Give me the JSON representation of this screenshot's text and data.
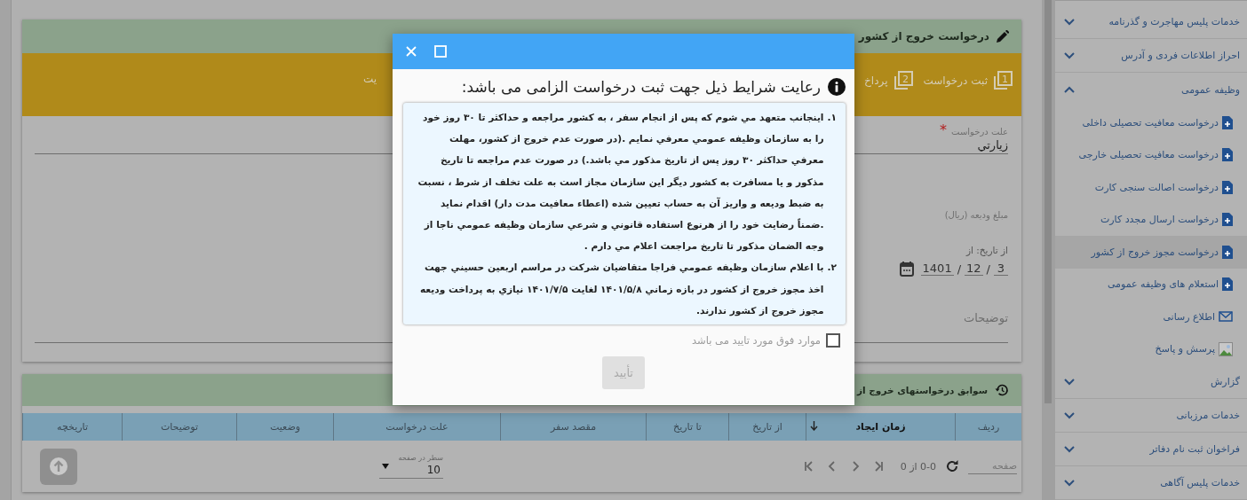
{
  "form_panel": {
    "title": "درخواست خروج از کشور",
    "steps": [
      {
        "number": "1",
        "label": "ثبت درخواست"
      },
      {
        "number": "2",
        "label": "پرداخ"
      },
      {
        "label": "يت"
      }
    ],
    "fields": [
      {
        "kind": "text",
        "label": "علت درخواست",
        "required_mark": "*",
        "value": "زيارتي"
      },
      {
        "kind": "label",
        "label": "مبلغ وديعه (ريال)"
      },
      {
        "kind": "date",
        "label": "از تاريخ: از",
        "parts": [
          {
            "kind": "field",
            "text": "3"
          },
          {
            "kind": "sep",
            "text": "/"
          },
          {
            "kind": "field",
            "text": "12"
          },
          {
            "kind": "sep",
            "text": "/"
          },
          {
            "kind": "field",
            "text": "1401"
          }
        ]
      },
      {
        "kind": "area",
        "placeholder": "توضيحات"
      }
    ]
  },
  "history_panel": {
    "title": "سوابق درخواستهای خروج از",
    "columns": [
      {
        "label": "ردیف",
        "sorted": false
      },
      {
        "label": "زمان ایجاد",
        "sorted": true
      },
      {
        "label": "از تاریخ",
        "sorted": false
      },
      {
        "label": "تا تاریخ",
        "sorted": false
      },
      {
        "label": "مقصد سفر",
        "sorted": false
      },
      {
        "label": "علت درخواست",
        "sorted": false
      },
      {
        "label": "وضعیت",
        "sorted": false
      },
      {
        "label": "توضیحات",
        "sorted": false
      },
      {
        "label": "تاریخچه",
        "sorted": false
      }
    ],
    "page_field": {
      "placeholder": "صفحه"
    },
    "range": "0-0 از 0",
    "page_size": {
      "label": "سطر در صفحه",
      "value": "10"
    }
  },
  "sidebar": {
    "items": [
      {
        "label": "خدمات پلیس مهاجرت و گذرنامه",
        "expanded": false
      },
      {
        "label": "احراز اطلاعات فردی و آدرس",
        "expanded": false
      },
      {
        "label": "وظیفه عمومی",
        "expanded": true,
        "children": [
          {
            "label": "درخواست معافیت تحصیلی داخلی",
            "kind": "document",
            "selected": false
          },
          {
            "label": "درخواست معافیت تحصیلی خارجی",
            "kind": "document",
            "selected": false
          },
          {
            "label": "درخواست اصالت سنجی کارت",
            "kind": "document",
            "selected": false
          },
          {
            "label": "درخواست ارسال مجدد کارت",
            "kind": "document",
            "selected": false
          },
          {
            "label": "درخواست مجوز خروج از کشور",
            "kind": "document",
            "selected": true
          },
          {
            "label": "استعلام های وظیفه عمومی",
            "kind": "document",
            "selected": false
          },
          {
            "label": "اطلاع رسانی",
            "kind": "mail",
            "selected": false
          },
          {
            "label": "پرسش و پاسخ",
            "kind": "image",
            "selected": false
          }
        ]
      },
      {
        "label": "گزارش",
        "expanded": false
      },
      {
        "label": "خدمات مرزبانی",
        "expanded": false
      },
      {
        "label": "فراخوان ثبت نام دفاتر",
        "expanded": false
      },
      {
        "label": "خدمات پلیس آگاهی",
        "expanded": false
      }
    ]
  },
  "dialog": {
    "title": "رعایت شرایط ذیل جهت ثبت درخواست الزامی می باشد:",
    "terms": [
      {
        "number": "۱.",
        "text": "اينجانب متعهد مي شوم که پس از انجام سفر ، به کشور مراجعه و حداکثر تا ۳۰ روز خود را به سازمان وظيفه عمومي معرفي نمايم .(در صورت عدم خروج از کشور، مهلت معرفي حداکثر ۳۰ روز پس از تاريخ مذکور مي باشد.) در صورت عدم مراجعه تا تاريخ مذکور و يا مسافرت به کشور ديگر اين سازمان مجاز است به علت تخلف از شرط ، نسبت به ضبط وديعه و واريز آن به حساب تعيين شده (اعطاء معافيت مدت دار) اقدام نمايد .ضمناً رضايت خود را از هرنوع استفاده قانوني و شرعي سازمان وظيفه عمومي ناجا از وجه الضمان مذکور تا تاريخ مراجعت اعلام مي دارم ."
      },
      {
        "number": "۲.",
        "text": "با اعلام سازمان وظيفه عمومي فراجا متقاضيان شرکت در مراسم اربعين حسيني جهت اخذ مجوز خروج از کشور در بازه زماني ۱۴۰۱/۵/۸ لغايت ۱۴۰۱/۷/۵ نيازي به پرداخت وديعه مجوز خروج از کشور ندارند."
      }
    ],
    "agree": {
      "label": "موارد فوق مورد تایید می باشد",
      "checked": false
    },
    "confirm": {
      "label": "تأیید",
      "disabled": true
    }
  }
}
